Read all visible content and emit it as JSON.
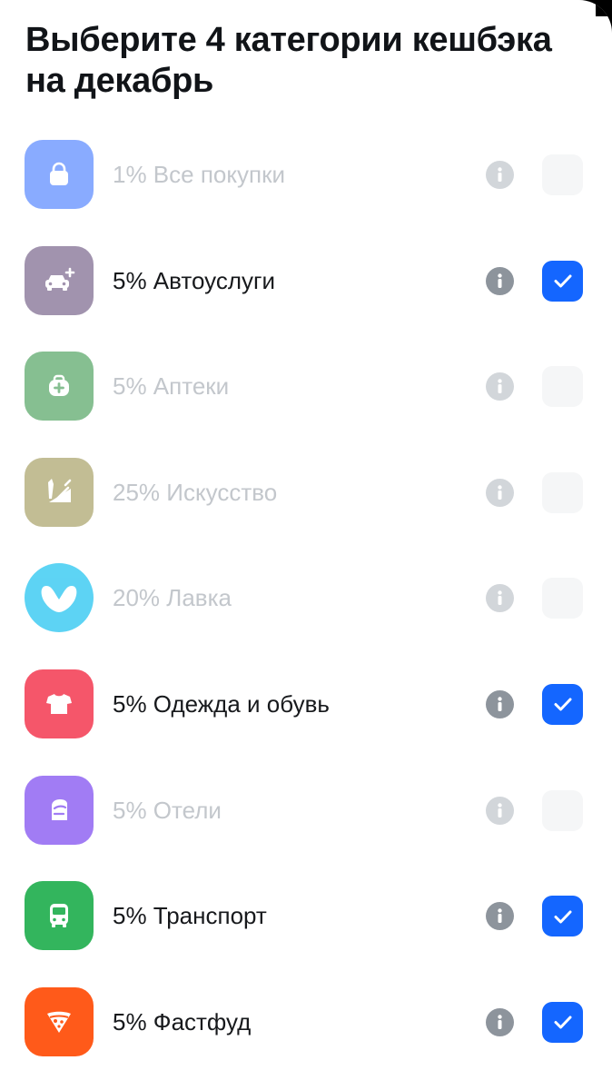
{
  "title": "Выберите 4 категории кешбэка на декабрь",
  "colors": {
    "accent": "#1466ff",
    "info_active": "#8d949c",
    "info_disabled": "#d2d6da",
    "text": "#17191c",
    "text_disabled": "#c3c7cc"
  },
  "categories": [
    {
      "label": "1% Все покупки",
      "icon": "shopping-bag-icon",
      "color": "#5d8cff",
      "checked": false,
      "enabled": false
    },
    {
      "label": "5% Автоуслуги",
      "icon": "car-service-icon",
      "color": "#a193ae",
      "checked": true,
      "enabled": true
    },
    {
      "label": "5% Аптеки",
      "icon": "first-aid-kit-icon",
      "color": "#58a768",
      "checked": false,
      "enabled": false
    },
    {
      "label": "25% Искусство",
      "icon": "art-supplies-icon",
      "color": "#aba46c",
      "checked": false,
      "enabled": false
    },
    {
      "label": "20% Лавка",
      "icon": "lavka-heart-icon",
      "color": "#1fc3f0",
      "checked": false,
      "enabled": false
    },
    {
      "label": "5% Одежда и обувь",
      "icon": "tshirt-icon",
      "color": "#f5566a",
      "checked": true,
      "enabled": true
    },
    {
      "label": "5% Отели",
      "icon": "hotel-icon",
      "color": "#7d4bf0",
      "checked": false,
      "enabled": false
    },
    {
      "label": "5% Транспорт",
      "icon": "bus-icon",
      "color": "#33b55d",
      "checked": true,
      "enabled": true
    },
    {
      "label": "5% Фастфуд",
      "icon": "pizza-icon",
      "color": "#ff5a1a",
      "checked": true,
      "enabled": true
    }
  ]
}
